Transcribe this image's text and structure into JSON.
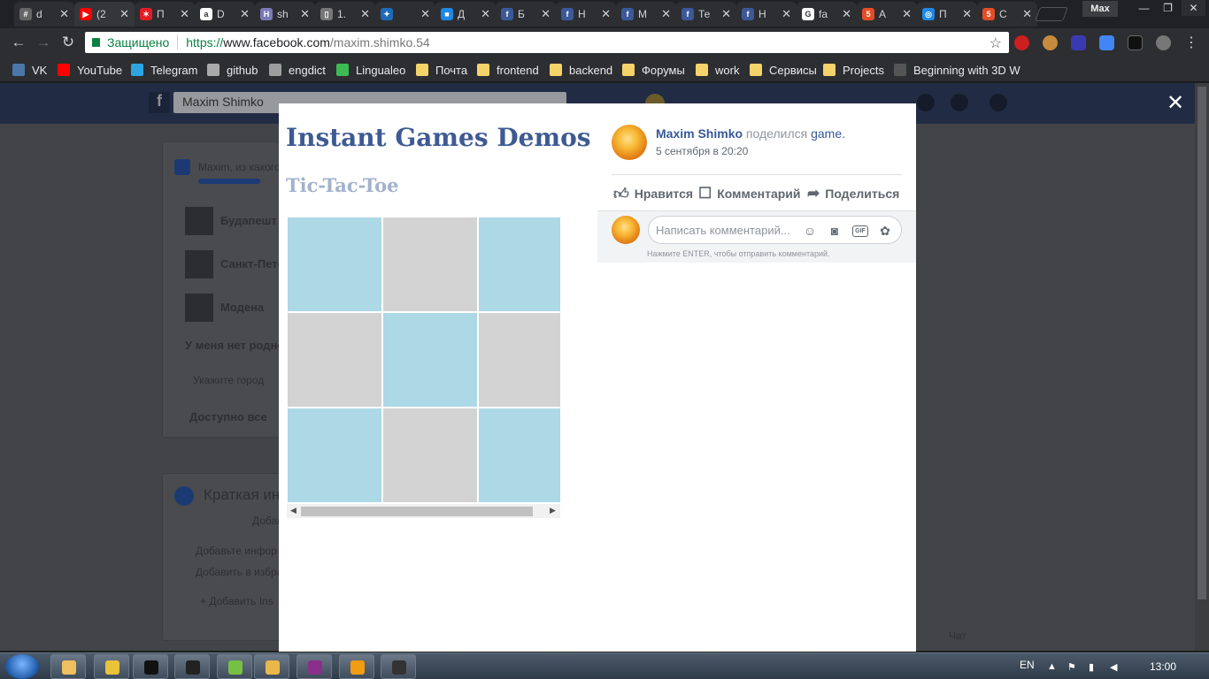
{
  "tabs": [
    {
      "title": "d",
      "fav_color": "#666",
      "glyph": "#"
    },
    {
      "title": "(2",
      "fav_color": "#ff0000",
      "glyph": "▶"
    },
    {
      "title": "П",
      "fav_color": "#e31c25",
      "glyph": "✶"
    },
    {
      "title": "D",
      "fav_color": "#ffffff",
      "glyph": "a"
    },
    {
      "title": "sh",
      "fav_color": "#7a7ab8",
      "glyph": "H"
    },
    {
      "title": "1.",
      "fav_color": "#777",
      "glyph": "▯"
    },
    {
      "title": "",
      "fav_color": "#1e6ab8",
      "glyph": "✦"
    },
    {
      "title": "Д",
      "fav_color": "#1e88e5",
      "glyph": "■"
    },
    {
      "title": "Б",
      "fav_color": "#3b5998",
      "glyph": "f"
    },
    {
      "title": "Н",
      "fav_color": "#3b5998",
      "glyph": "f"
    },
    {
      "title": "М",
      "fav_color": "#3b5998",
      "glyph": "f"
    },
    {
      "title": "Те",
      "fav_color": "#3b5998",
      "glyph": "f"
    },
    {
      "title": "Н",
      "fav_color": "#3b5998",
      "glyph": "f"
    },
    {
      "title": "fa",
      "fav_color": "#ffffff",
      "glyph": "G"
    },
    {
      "title": "A",
      "fav_color": "#e44d26",
      "glyph": "5"
    },
    {
      "title": "П",
      "fav_color": "#1e88e5",
      "glyph": "◎"
    },
    {
      "title": "С",
      "fav_color": "#e44d26",
      "glyph": "5"
    }
  ],
  "window": {
    "profile": "Max"
  },
  "toolbar": {
    "secure_label": "Защищено",
    "url_scheme": "https://",
    "url_host": "www.facebook.com",
    "url_path": "/maxim.shimko.54"
  },
  "bookmarks": [
    {
      "label": "VK",
      "color": "#4a76a8"
    },
    {
      "label": "YouTube",
      "color": "#ff0000"
    },
    {
      "label": "Telegram",
      "color": "#2ca5e0"
    },
    {
      "label": "github",
      "color": "#aaaaaa"
    },
    {
      "label": "engdict",
      "color": "#9e9e9e"
    },
    {
      "label": "Lingualeo",
      "color": "#3cba54"
    },
    {
      "label": "Почта",
      "color": "#f5d36b"
    },
    {
      "label": "frontend",
      "color": "#f5d36b"
    },
    {
      "label": "backend",
      "color": "#f5d36b"
    },
    {
      "label": "Форумы",
      "color": "#f5d36b"
    },
    {
      "label": "work",
      "color": "#f5d36b"
    },
    {
      "label": "Сервисы",
      "color": "#f5d36b"
    },
    {
      "label": "Projects",
      "color": "#f5d36b"
    },
    {
      "label": "Beginning with 3D W",
      "color": "#555555"
    }
  ],
  "facebook_bg": {
    "search_value": "Maxim Shimko",
    "prompt": "Maxim, из какого",
    "cities": [
      "Будапешт",
      "Санкт-Пете",
      "Модена"
    ],
    "no_hometown": "У меня нет родно",
    "city_placeholder": "Укажите город",
    "available": "Доступно все",
    "intro_title": "Краткая инф",
    "add_hint": "Добав",
    "add_info": "Добавьте инфор",
    "add_featured": "Добавить в избра",
    "add_button": "+ Добавить Ins",
    "chat": "Чат"
  },
  "game": {
    "title": "Instant Games Demos",
    "subtitle": "Tic-Tac-Toe",
    "cells": [
      "blue",
      "gray",
      "blue",
      "gray",
      "blue",
      "gray",
      "blue",
      "gray",
      "blue"
    ],
    "colors": {
      "blue": "#add8e6",
      "gray": "#d3d3d3"
    }
  },
  "post": {
    "author": "Maxim Shimko",
    "shared_text": "поделился",
    "shared_object": "game.",
    "time": "5 сентября в 20:20",
    "like": "Нравится",
    "comment": "Комментарий",
    "share": "Поделиться",
    "comment_placeholder": "Написать комментарий...",
    "gif_label": "GIF",
    "hint": "Нажмите ENTER, чтобы отправить комментарий."
  },
  "taskbar": {
    "lang": "EN",
    "time": "13:00",
    "apps": [
      {
        "name": "explorer",
        "color": "#f0c060"
      },
      {
        "name": "chrome",
        "color": "#e9c33a"
      },
      {
        "name": "webstorm",
        "color": "#111111"
      },
      {
        "name": "cmd",
        "color": "#222222"
      },
      {
        "name": "android",
        "color": "#76c043"
      },
      {
        "name": "paint",
        "color": "#e8b94a"
      },
      {
        "name": "winrar",
        "color": "#8a2f8a"
      },
      {
        "name": "sublime",
        "color": "#f39c12"
      },
      {
        "name": "other",
        "color": "#333333"
      }
    ]
  }
}
